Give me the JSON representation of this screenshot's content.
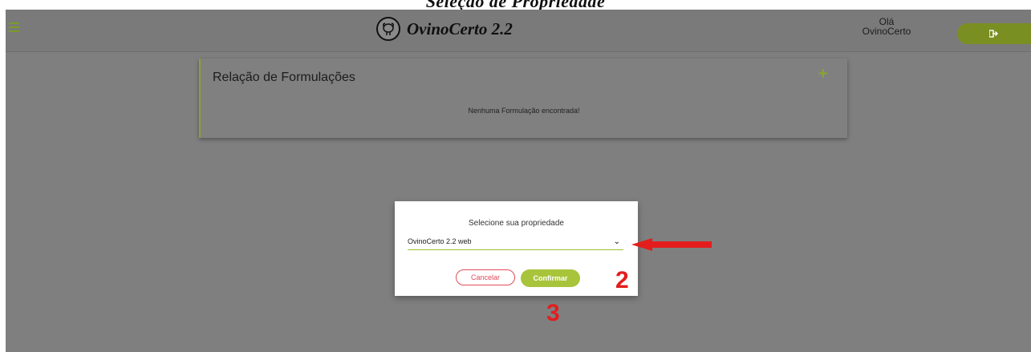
{
  "caption": "Seleção de Propriedade",
  "header": {
    "app_title": "OvinoCerto 2.2",
    "greeting_line1": "Olá",
    "greeting_line2": "OvinoCerto",
    "logout_icon": "sign-out-icon",
    "menu_icon": "hamburger-menu-icon",
    "accent_color": "#7a8f22"
  },
  "card": {
    "title": "Relação de Formulações",
    "add_label": "+",
    "empty_message": "Nenhuma Formulação encontrada!"
  },
  "modal": {
    "title": "Selecione sua propriedade",
    "select_value": "OvinoCerto 2.2 web",
    "cancel_label": "Cancelar",
    "confirm_label": "Confirmar"
  },
  "annotations": {
    "step2": "2",
    "step3": "3",
    "color": "#e31d1d"
  }
}
